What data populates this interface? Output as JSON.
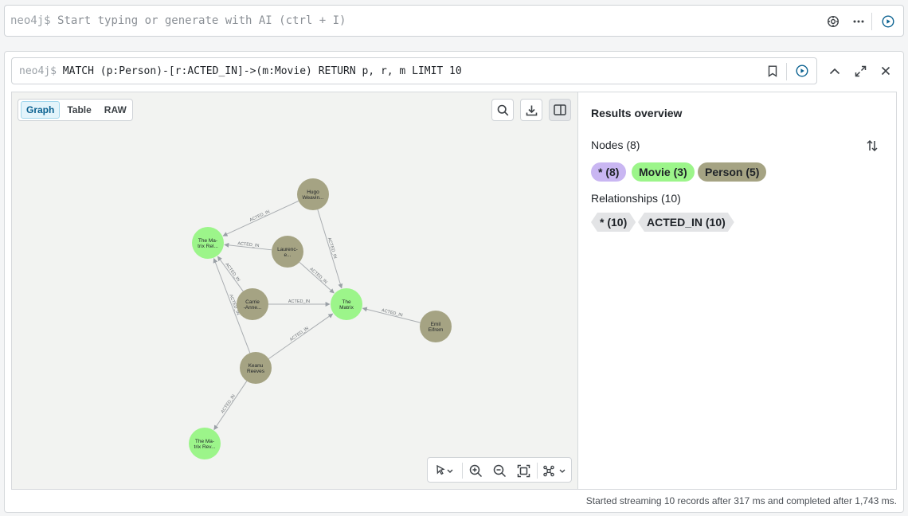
{
  "editor": {
    "prompt": "neo4j$",
    "placeholder": "Start typing or generate with AI (ctrl + I)"
  },
  "query": {
    "prompt": "neo4j$",
    "text": "MATCH (p:Person)-[r:ACTED_IN]->(m:Movie) RETURN p, r, m LIMIT 10"
  },
  "view_tabs": [
    "Graph",
    "Table",
    "RAW"
  ],
  "active_tab": "Graph",
  "graph": {
    "node_colors": {
      "Movie": "#9cf58a",
      "Person": "#a5a383"
    },
    "nodes": [
      {
        "id": "hugo",
        "label1": "Hugo",
        "label2": "Weavin...",
        "type": "Person"
      },
      {
        "id": "matrix_rel",
        "label1": "The Ma-",
        "label2": "trix Rel...",
        "type": "Movie"
      },
      {
        "id": "laurence",
        "label1": "Laurenc-",
        "label2": "e...",
        "type": "Person"
      },
      {
        "id": "carrie",
        "label1": "Carrie",
        "label2": "-Anne...",
        "type": "Person"
      },
      {
        "id": "matrix",
        "label1": "The",
        "label2": "Matrix",
        "type": "Movie"
      },
      {
        "id": "emil",
        "label1": "Emil",
        "label2": "Eifrem",
        "type": "Person"
      },
      {
        "id": "keanu",
        "label1": "Keanu",
        "label2": "Reeves",
        "type": "Person"
      },
      {
        "id": "matrix_rev",
        "label1": "The Ma-",
        "label2": "trix Rev...",
        "type": "Movie"
      }
    ],
    "edges": [
      {
        "from": "hugo",
        "to": "matrix_rel",
        "label": "ACTED_IN"
      },
      {
        "from": "hugo",
        "to": "matrix",
        "label": "ACTED_IN"
      },
      {
        "from": "laurence",
        "to": "matrix_rel",
        "label": "ACTED_IN"
      },
      {
        "from": "laurence",
        "to": "matrix",
        "label": "ACTED_IN"
      },
      {
        "from": "carrie",
        "to": "matrix_rel",
        "label": "ACTED_IN"
      },
      {
        "from": "carrie",
        "to": "matrix",
        "label": "ACTED_IN"
      },
      {
        "from": "keanu",
        "to": "matrix_rel",
        "label": "ACTED_IN"
      },
      {
        "from": "keanu",
        "to": "matrix",
        "label": "ACTED_IN"
      },
      {
        "from": "keanu",
        "to": "matrix_rev",
        "label": "ACTED_IN"
      },
      {
        "from": "emil",
        "to": "matrix",
        "label": "ACTED_IN"
      }
    ]
  },
  "overview": {
    "title": "Results overview",
    "nodes_label": "Nodes (8)",
    "node_pills": [
      {
        "text": "* (8)",
        "color": "#c9b6f2"
      },
      {
        "text": "Movie (3)",
        "color": "#9cf58a"
      },
      {
        "text": "Person (5)",
        "color": "#a5a383"
      }
    ],
    "relationships_label": "Relationships (10)",
    "rel_pills": [
      "* (10)",
      "ACTED_IN (10)"
    ]
  },
  "status": "Started streaming 10 records after 317 ms and completed after 1,743 ms."
}
